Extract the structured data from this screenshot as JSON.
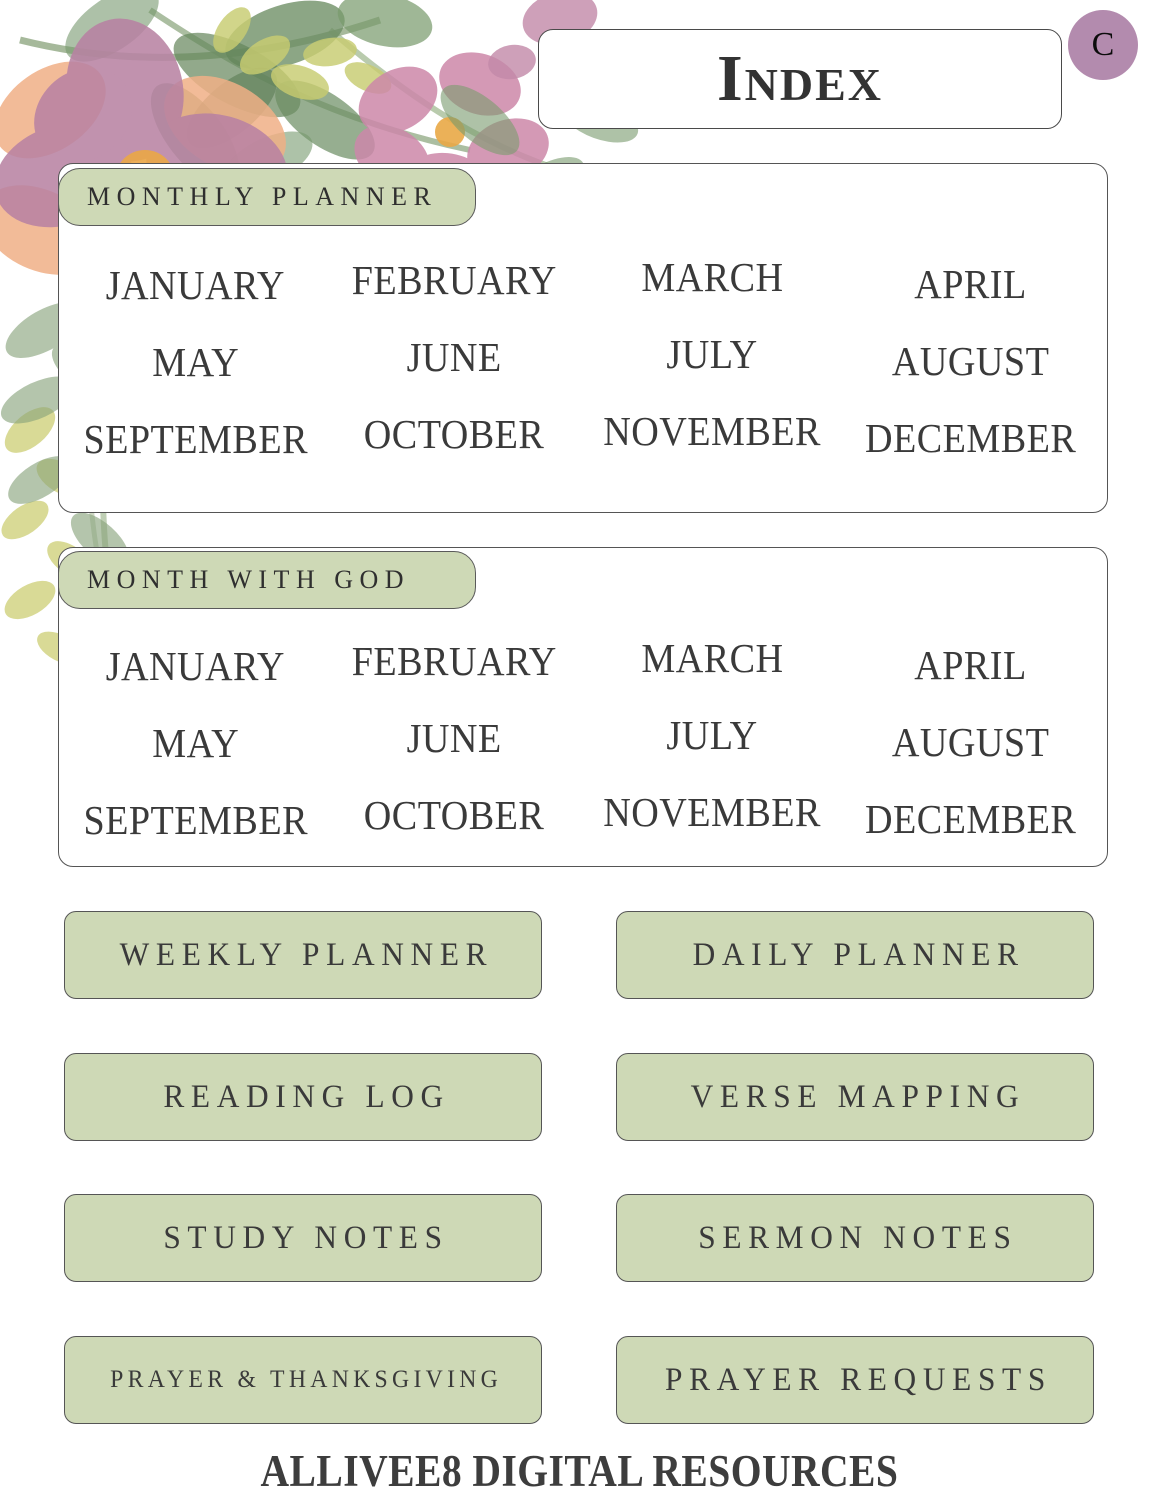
{
  "header": {
    "title": "Index",
    "badge_letter": "C",
    "badge_color": "#b38bae"
  },
  "sections": [
    {
      "pill_label": "MONTHLY PLANNER",
      "months": [
        "JANUARY",
        "FEBRUARY",
        "MARCH",
        "APRIL",
        "MAY",
        "JUNE",
        "JULY",
        "AUGUST",
        "SEPTEMBER",
        "OCTOBER",
        "NOVEMBER",
        "DECEMBER"
      ]
    },
    {
      "pill_label": "MONTH WITH GOD",
      "months": [
        "JANUARY",
        "FEBRUARY",
        "MARCH",
        "APRIL",
        "MAY",
        "JUNE",
        "JULY",
        "AUGUST",
        "SEPTEMBER",
        "OCTOBER",
        "NOVEMBER",
        "DECEMBER"
      ]
    }
  ],
  "buttons": [
    {
      "label": "WEEKLY PLANNER"
    },
    {
      "label": "DAILY PLANNER"
    },
    {
      "label": "READING LOG"
    },
    {
      "label": "VERSE MAPPING"
    },
    {
      "label": "STUDY NOTES"
    },
    {
      "label": "SERMON NOTES"
    },
    {
      "label": "PRAYER & THANKSGIVING"
    },
    {
      "label": "PRAYER REQUESTS"
    }
  ],
  "footer": {
    "text": "ALLIVEE8 DIGITAL RESOURCES"
  },
  "theme": {
    "sage_green": "#ced9b6",
    "border_dark": "#555555",
    "text_dark": "#3a3a3a",
    "page_background": "#ffffff"
  },
  "decoration": {
    "name": "watercolor-floral-corner",
    "flower_mauve": "#b5789c",
    "flower_peach": "#f0a878",
    "flower_pink": "#c9799f",
    "leaf_green": "#6f8f63",
    "leaf_olive": "#c6c864",
    "center_orange": "#e8a135"
  }
}
